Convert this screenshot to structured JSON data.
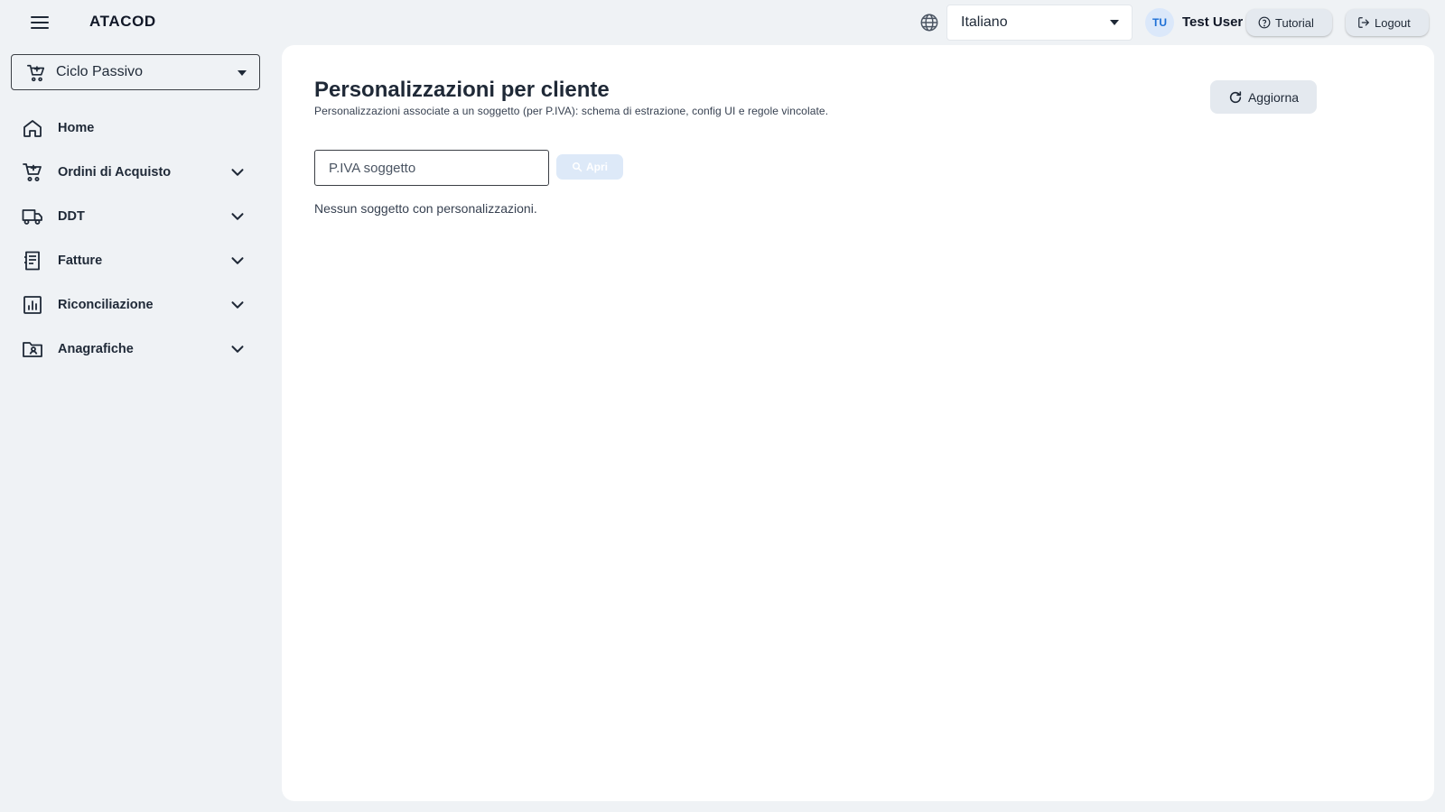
{
  "header": {
    "brand": "ATACOD",
    "language": "Italiano",
    "user_initials": "TU",
    "user_name": "Test User",
    "tutorial_label": "Tutorial",
    "logout_label": "Logout"
  },
  "sidebar": {
    "module": "Ciclo Passivo",
    "items": [
      {
        "label": "Home",
        "icon": "home-icon",
        "expandable": false
      },
      {
        "label": "Ordini di Acquisto",
        "icon": "cart-icon",
        "expandable": true
      },
      {
        "label": "DDT",
        "icon": "truck-icon",
        "expandable": true
      },
      {
        "label": "Fatture",
        "icon": "invoice-icon",
        "expandable": true
      },
      {
        "label": "Riconciliazione",
        "icon": "chart-icon",
        "expandable": true
      },
      {
        "label": "Anagrafiche",
        "icon": "contacts-folder-icon",
        "expandable": true
      }
    ]
  },
  "main": {
    "title": "Personalizzazioni per cliente",
    "subtitle": "Personalizzazioni associate a un soggetto (per P.IVA): schema di estrazione, config UI e regole vincolate.",
    "refresh_label": "Aggiorna",
    "piva_placeholder": "P.IVA soggetto",
    "piva_value": "",
    "open_label": "Apri",
    "empty_message": "Nessun soggetto con personalizzazioni."
  },
  "colors": {
    "background": "#eff2f5",
    "card": "#ffffff",
    "accent": "#1d6fd6",
    "disabled_button": "#dde9f8",
    "neutral_button": "#e4e9ef"
  }
}
